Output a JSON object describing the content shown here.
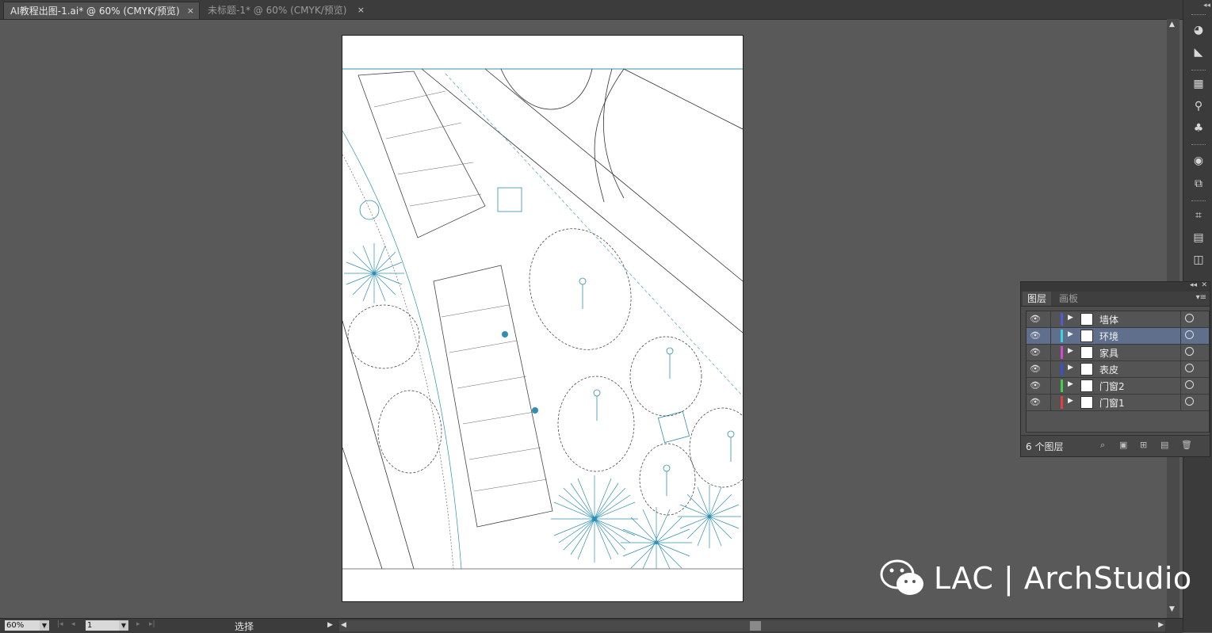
{
  "tabs": [
    {
      "label": "AI教程出图-1.ai* @ 60% (CMYK/预览)",
      "close": "×"
    },
    {
      "label": "未标题-1* @ 60% (CMYK/预览)",
      "close": "×"
    }
  ],
  "layers_panel": {
    "tab_layers": "图层",
    "tab_artboards": "画板",
    "collapse_icon": "double-left-arrow-icon",
    "close_icon": "close-icon",
    "menu_icon": "panel-menu-icon",
    "layers": [
      {
        "name": "墙体",
        "color": "#4a5fd6",
        "selected": false
      },
      {
        "name": "环境",
        "color": "#3fd1e0",
        "selected": true
      },
      {
        "name": "家具",
        "color": "#d14ad1",
        "selected": false
      },
      {
        "name": "表皮",
        "color": "#3a4fd0",
        "selected": false
      },
      {
        "name": "门窗2",
        "color": "#3fd14a",
        "selected": false
      },
      {
        "name": "门窗1",
        "color": "#e04040",
        "selected": false
      }
    ],
    "layer_count": "6 个图层"
  },
  "statusbar": {
    "zoom": "60%",
    "page": "1",
    "tool_status": "选择"
  },
  "watermark": {
    "text": "LAC | ArchStudio",
    "icon": "wechat-icon"
  },
  "colors": {
    "drawing_accent": "#2f8fb0",
    "selected_layer": "#5f6f8c"
  }
}
